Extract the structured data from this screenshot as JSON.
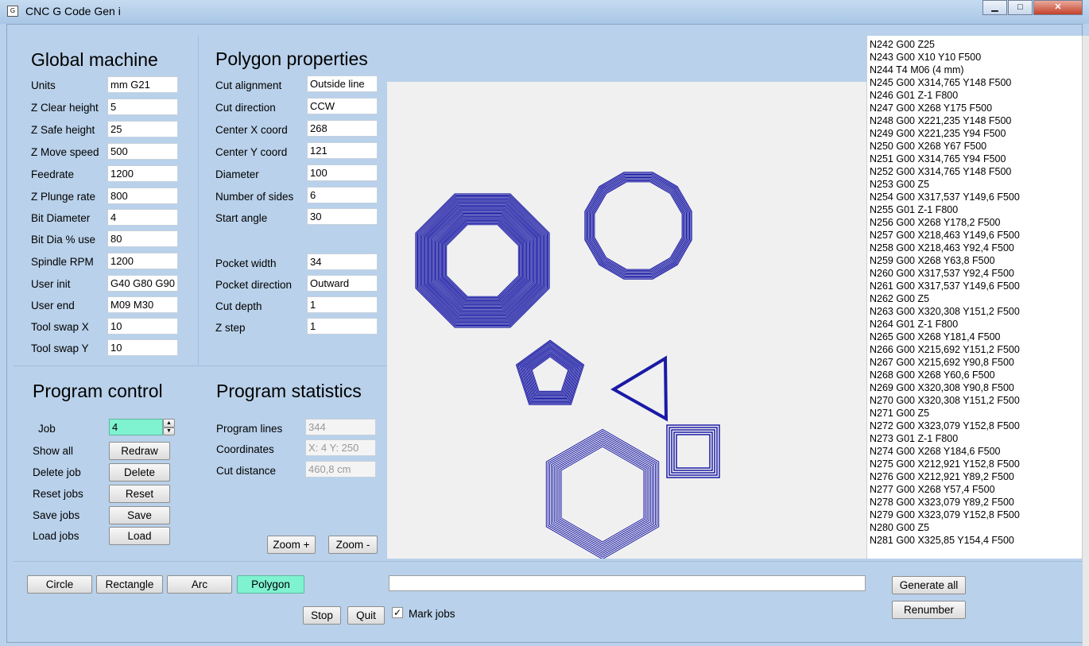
{
  "window": {
    "title": "CNC G Code Gen i",
    "minimize": "▁",
    "maximize": "□",
    "close": "✕"
  },
  "global": {
    "heading": "Global machine",
    "rows": [
      {
        "label": "Units",
        "value": "mm G21"
      },
      {
        "label": "Z Clear height",
        "value": "5"
      },
      {
        "label": "Z Safe height",
        "value": "25"
      },
      {
        "label": "Z Move speed",
        "value": "500"
      },
      {
        "label": "Feedrate",
        "value": "1200"
      },
      {
        "label": "Z Plunge rate",
        "value": "800"
      },
      {
        "label": "Bit Diameter",
        "value": "4"
      },
      {
        "label": "Bit Dia % use",
        "value": "80"
      },
      {
        "label": "Spindle RPM",
        "value": "1200"
      },
      {
        "label": "User init",
        "value": "G40 G80 G90"
      },
      {
        "label": "User end",
        "value": "M09 M30"
      },
      {
        "label": "Tool swap X",
        "value": "10"
      },
      {
        "label": "Tool swap Y",
        "value": "10"
      }
    ]
  },
  "polygon": {
    "heading": "Polygon properties",
    "rows": [
      {
        "label": "Cut alignment",
        "value": "Outside line"
      },
      {
        "label": "Cut direction",
        "value": "CCW"
      },
      {
        "label": "Center X coord",
        "value": "268"
      },
      {
        "label": "Center Y coord",
        "value": "121"
      },
      {
        "label": "Diameter",
        "value": "100"
      },
      {
        "label": "Number of sides",
        "value": "6"
      },
      {
        "label": "Start angle",
        "value": "30"
      },
      {
        "label": "Pocket width",
        "value": "34"
      },
      {
        "label": "Pocket direction",
        "value": "Outward"
      },
      {
        "label": "Cut depth",
        "value": "1"
      },
      {
        "label": "Z step",
        "value": "1"
      }
    ]
  },
  "control": {
    "heading": "Program control",
    "job_label": "Job",
    "job_value": "4",
    "rows": [
      {
        "label": "Show all",
        "button": "Redraw"
      },
      {
        "label": "Delete job",
        "button": "Delete"
      },
      {
        "label": "Reset jobs",
        "button": "Reset"
      },
      {
        "label": "Save jobs",
        "button": "Save"
      },
      {
        "label": "Load jobs",
        "button": "Load"
      }
    ]
  },
  "stats": {
    "heading": "Program statistics",
    "rows": [
      {
        "label": "Program lines",
        "value": "344"
      },
      {
        "label": "Coordinates",
        "value": "X: 4  Y: 250"
      },
      {
        "label": "Cut distance",
        "value": "460,8 cm"
      }
    ],
    "zoom_in": "Zoom +",
    "zoom_out": "Zoom -"
  },
  "shapes": {
    "stroke_color": "#1a1aa6"
  },
  "gcode": [
    "N242 G00 Z25",
    "N243 G00 X10 Y10 F500",
    "N244 T4 M06 (4 mm)",
    "N245 G00 X314,765 Y148 F500",
    "N246 G01 Z-1 F800",
    "N247 G00 X268 Y175 F500",
    "N248 G00 X221,235 Y148 F500",
    "N249 G00 X221,235 Y94 F500",
    "N250 G00 X268 Y67 F500",
    "N251 G00 X314,765 Y94 F500",
    "N252 G00 X314,765 Y148 F500",
    "N253 G00 Z5",
    "N254 G00 X317,537 Y149,6 F500",
    "N255 G01 Z-1 F800",
    "N256 G00 X268 Y178,2 F500",
    "N257 G00 X218,463 Y149,6 F500",
    "N258 G00 X218,463 Y92,4 F500",
    "N259 G00 X268 Y63,8 F500",
    "N260 G00 X317,537 Y92,4 F500",
    "N261 G00 X317,537 Y149,6 F500",
    "N262 G00 Z5",
    "N263 G00 X320,308 Y151,2 F500",
    "N264 G01 Z-1 F800",
    "N265 G00 X268 Y181,4 F500",
    "N266 G00 X215,692 Y151,2 F500",
    "N267 G00 X215,692 Y90,8 F500",
    "N268 G00 X268 Y60,6 F500",
    "N269 G00 X320,308 Y90,8 F500",
    "N270 G00 X320,308 Y151,2 F500",
    "N271 G00 Z5",
    "N272 G00 X323,079 Y152,8 F500",
    "N273 G01 Z-1 F800",
    "N274 G00 X268 Y184,6 F500",
    "N275 G00 X212,921 Y152,8 F500",
    "N276 G00 X212,921 Y89,2 F500",
    "N277 G00 X268 Y57,4 F500",
    "N278 G00 X323,079 Y89,2 F500",
    "N279 G00 X323,079 Y152,8 F500",
    "N280 G00 Z5",
    "N281 G00 X325,85 Y154,4 F500"
  ],
  "bottom": {
    "tool_buttons": [
      "Circle",
      "Rectangle",
      "Arc",
      "Polygon"
    ],
    "stop": "Stop",
    "quit": "Quit",
    "mark_jobs": "Mark jobs",
    "mark_checked": true,
    "generate": "Generate all",
    "renumber": "Renumber",
    "progress": 0
  }
}
